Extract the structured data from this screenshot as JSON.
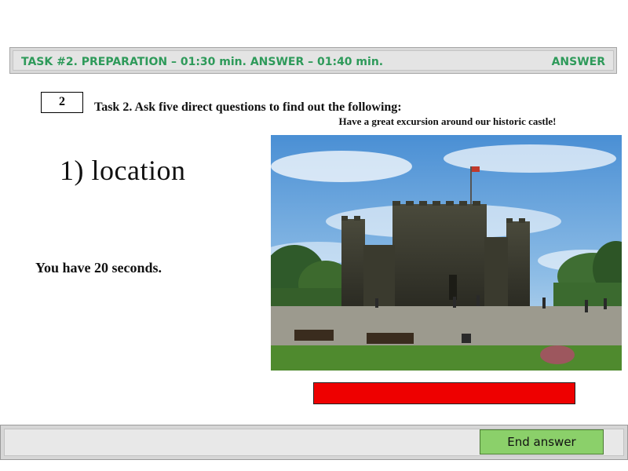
{
  "header": {
    "task_title": "TASK #2. PREPARATION – 01:30 min. ANSWER – 01:40 min.",
    "answer_label": "ANSWER"
  },
  "task": {
    "number": "2",
    "instruction": "Task 2.  Ask five direct questions to find out the following:"
  },
  "item": {
    "text": "1) location"
  },
  "timer": {
    "text": "You have 20 seconds."
  },
  "ad": {
    "caption": "Have a great excursion around our historic castle!"
  },
  "footer": {
    "end_button": "End answer"
  },
  "colors": {
    "accent_green": "#2e9a5a",
    "progress_red": "#ee0000",
    "button_green": "#8bd06a"
  }
}
